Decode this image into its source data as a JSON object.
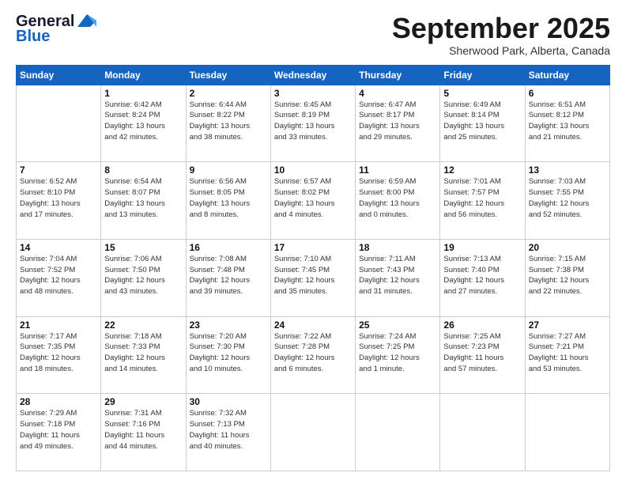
{
  "header": {
    "logo_line1": "General",
    "logo_line2": "Blue",
    "month": "September 2025",
    "location": "Sherwood Park, Alberta, Canada"
  },
  "days_of_week": [
    "Sunday",
    "Monday",
    "Tuesday",
    "Wednesday",
    "Thursday",
    "Friday",
    "Saturday"
  ],
  "weeks": [
    [
      {
        "day": "",
        "info": ""
      },
      {
        "day": "1",
        "info": "Sunrise: 6:42 AM\nSunset: 8:24 PM\nDaylight: 13 hours\nand 42 minutes."
      },
      {
        "day": "2",
        "info": "Sunrise: 6:44 AM\nSunset: 8:22 PM\nDaylight: 13 hours\nand 38 minutes."
      },
      {
        "day": "3",
        "info": "Sunrise: 6:45 AM\nSunset: 8:19 PM\nDaylight: 13 hours\nand 33 minutes."
      },
      {
        "day": "4",
        "info": "Sunrise: 6:47 AM\nSunset: 8:17 PM\nDaylight: 13 hours\nand 29 minutes."
      },
      {
        "day": "5",
        "info": "Sunrise: 6:49 AM\nSunset: 8:14 PM\nDaylight: 13 hours\nand 25 minutes."
      },
      {
        "day": "6",
        "info": "Sunrise: 6:51 AM\nSunset: 8:12 PM\nDaylight: 13 hours\nand 21 minutes."
      }
    ],
    [
      {
        "day": "7",
        "info": "Sunrise: 6:52 AM\nSunset: 8:10 PM\nDaylight: 13 hours\nand 17 minutes."
      },
      {
        "day": "8",
        "info": "Sunrise: 6:54 AM\nSunset: 8:07 PM\nDaylight: 13 hours\nand 13 minutes."
      },
      {
        "day": "9",
        "info": "Sunrise: 6:56 AM\nSunset: 8:05 PM\nDaylight: 13 hours\nand 8 minutes."
      },
      {
        "day": "10",
        "info": "Sunrise: 6:57 AM\nSunset: 8:02 PM\nDaylight: 13 hours\nand 4 minutes."
      },
      {
        "day": "11",
        "info": "Sunrise: 6:59 AM\nSunset: 8:00 PM\nDaylight: 13 hours\nand 0 minutes."
      },
      {
        "day": "12",
        "info": "Sunrise: 7:01 AM\nSunset: 7:57 PM\nDaylight: 12 hours\nand 56 minutes."
      },
      {
        "day": "13",
        "info": "Sunrise: 7:03 AM\nSunset: 7:55 PM\nDaylight: 12 hours\nand 52 minutes."
      }
    ],
    [
      {
        "day": "14",
        "info": "Sunrise: 7:04 AM\nSunset: 7:52 PM\nDaylight: 12 hours\nand 48 minutes."
      },
      {
        "day": "15",
        "info": "Sunrise: 7:06 AM\nSunset: 7:50 PM\nDaylight: 12 hours\nand 43 minutes."
      },
      {
        "day": "16",
        "info": "Sunrise: 7:08 AM\nSunset: 7:48 PM\nDaylight: 12 hours\nand 39 minutes."
      },
      {
        "day": "17",
        "info": "Sunrise: 7:10 AM\nSunset: 7:45 PM\nDaylight: 12 hours\nand 35 minutes."
      },
      {
        "day": "18",
        "info": "Sunrise: 7:11 AM\nSunset: 7:43 PM\nDaylight: 12 hours\nand 31 minutes."
      },
      {
        "day": "19",
        "info": "Sunrise: 7:13 AM\nSunset: 7:40 PM\nDaylight: 12 hours\nand 27 minutes."
      },
      {
        "day": "20",
        "info": "Sunrise: 7:15 AM\nSunset: 7:38 PM\nDaylight: 12 hours\nand 22 minutes."
      }
    ],
    [
      {
        "day": "21",
        "info": "Sunrise: 7:17 AM\nSunset: 7:35 PM\nDaylight: 12 hours\nand 18 minutes."
      },
      {
        "day": "22",
        "info": "Sunrise: 7:18 AM\nSunset: 7:33 PM\nDaylight: 12 hours\nand 14 minutes."
      },
      {
        "day": "23",
        "info": "Sunrise: 7:20 AM\nSunset: 7:30 PM\nDaylight: 12 hours\nand 10 minutes."
      },
      {
        "day": "24",
        "info": "Sunrise: 7:22 AM\nSunset: 7:28 PM\nDaylight: 12 hours\nand 6 minutes."
      },
      {
        "day": "25",
        "info": "Sunrise: 7:24 AM\nSunset: 7:25 PM\nDaylight: 12 hours\nand 1 minute."
      },
      {
        "day": "26",
        "info": "Sunrise: 7:25 AM\nSunset: 7:23 PM\nDaylight: 11 hours\nand 57 minutes."
      },
      {
        "day": "27",
        "info": "Sunrise: 7:27 AM\nSunset: 7:21 PM\nDaylight: 11 hours\nand 53 minutes."
      }
    ],
    [
      {
        "day": "28",
        "info": "Sunrise: 7:29 AM\nSunset: 7:18 PM\nDaylight: 11 hours\nand 49 minutes."
      },
      {
        "day": "29",
        "info": "Sunrise: 7:31 AM\nSunset: 7:16 PM\nDaylight: 11 hours\nand 44 minutes."
      },
      {
        "day": "30",
        "info": "Sunrise: 7:32 AM\nSunset: 7:13 PM\nDaylight: 11 hours\nand 40 minutes."
      },
      {
        "day": "",
        "info": ""
      },
      {
        "day": "",
        "info": ""
      },
      {
        "day": "",
        "info": ""
      },
      {
        "day": "",
        "info": ""
      }
    ]
  ]
}
